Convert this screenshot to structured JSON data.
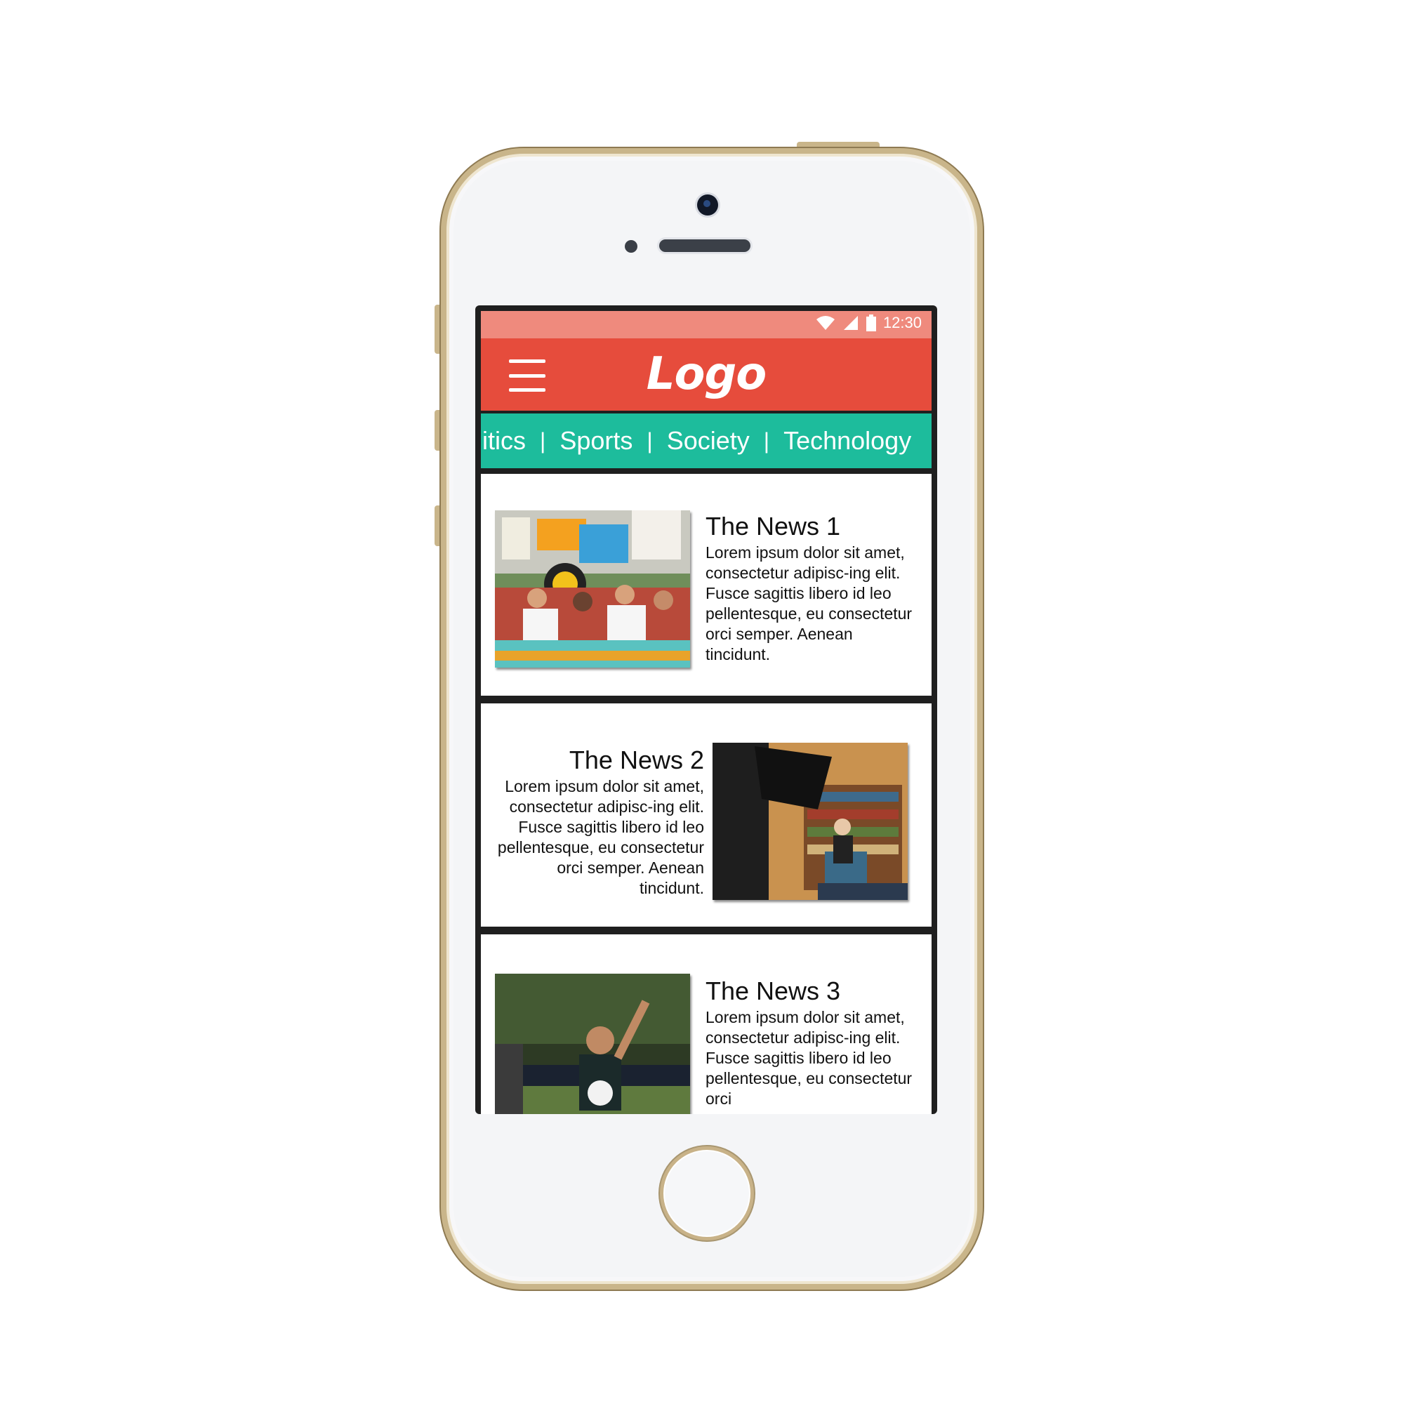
{
  "statusbar": {
    "time": "12:30"
  },
  "appbar": {
    "logo": "Logo"
  },
  "tabs": [
    "olitics",
    "Sports",
    "Society",
    "Technology"
  ],
  "tab_separator": "|",
  "news": [
    {
      "title": "The News 1",
      "body": "Lorem ipsum dolor sit amet, consectetur adipisc-ing elit. Fusce sagittis libero id leo pellentesque, eu consectetur orci semper. Aenean tincidunt."
    },
    {
      "title": "The News 2",
      "body": "Lorem ipsum dolor sit amet, consectetur adipisc-ing elit. Fusce sagittis libero id leo pellentesque, eu consectetur orci semper. Aenean tincidunt."
    },
    {
      "title": "The News 3",
      "body": "Lorem ipsum dolor sit amet, consectetur adipisc-ing elit. Fusce sagittis libero id leo pellentesque, eu consectetur orci"
    }
  ],
  "colors": {
    "statusbar": "#ef8a7d",
    "appbar": "#e64c3c",
    "tabsbar": "#1dbc9c",
    "phone_frame": "#c9b58a"
  },
  "icons": [
    "wifi-icon",
    "signal-icon",
    "battery-icon",
    "menu-icon"
  ]
}
